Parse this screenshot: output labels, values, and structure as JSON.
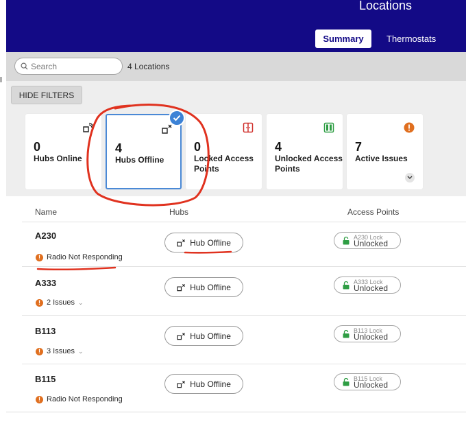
{
  "header": {
    "title": "Locations",
    "tabs": [
      {
        "label": "Summary",
        "active": true
      },
      {
        "label": "Thermostats",
        "active": false
      }
    ],
    "bg_color": "#130a86"
  },
  "search": {
    "placeholder": "Search",
    "count_text": "4 Locations"
  },
  "filters": {
    "toggle_label": "HIDE FILTERS",
    "cards": [
      {
        "value": "0",
        "label": "Hubs Online",
        "icon": "hub-online-icon",
        "selected": false
      },
      {
        "value": "4",
        "label": "Hubs Offline",
        "icon": "hub-offline-icon",
        "selected": true
      },
      {
        "value": "0",
        "label": "Locked Access Points",
        "icon": "locked-door-icon",
        "selected": false
      },
      {
        "value": "4",
        "label": "Unlocked Access Points",
        "icon": "unlocked-door-icon",
        "selected": false
      },
      {
        "value": "7",
        "label": "Active Issues",
        "icon": "alert-icon",
        "selected": false
      }
    ]
  },
  "table": {
    "columns": [
      "Name",
      "Hubs",
      "Access Points"
    ],
    "rows": [
      {
        "name": "A230",
        "status": "Radio Not Responding",
        "hub": "Hub Offline",
        "ap_name": "A230 Lock",
        "ap_state": "Unlocked"
      },
      {
        "name": "A333",
        "status": "2 Issues",
        "hub": "Hub Offline",
        "ap_name": "A333 Lock",
        "ap_state": "Unlocked"
      },
      {
        "name": "B113",
        "status": "3 Issues",
        "hub": "Hub Offline",
        "ap_name": "B113 Lock",
        "ap_state": "Unlocked"
      },
      {
        "name": "B115",
        "status": "Radio Not Responding",
        "hub": "Hub Offline",
        "ap_name": "B115 Lock",
        "ap_state": "Unlocked"
      }
    ]
  },
  "colors": {
    "accent": "#130a86",
    "selected_border": "#4a89d6",
    "issue_orange": "#e06f1f",
    "locked_red": "#d0312d",
    "unlocked_green": "#2f9e44",
    "annotation_red": "#e0321f"
  }
}
